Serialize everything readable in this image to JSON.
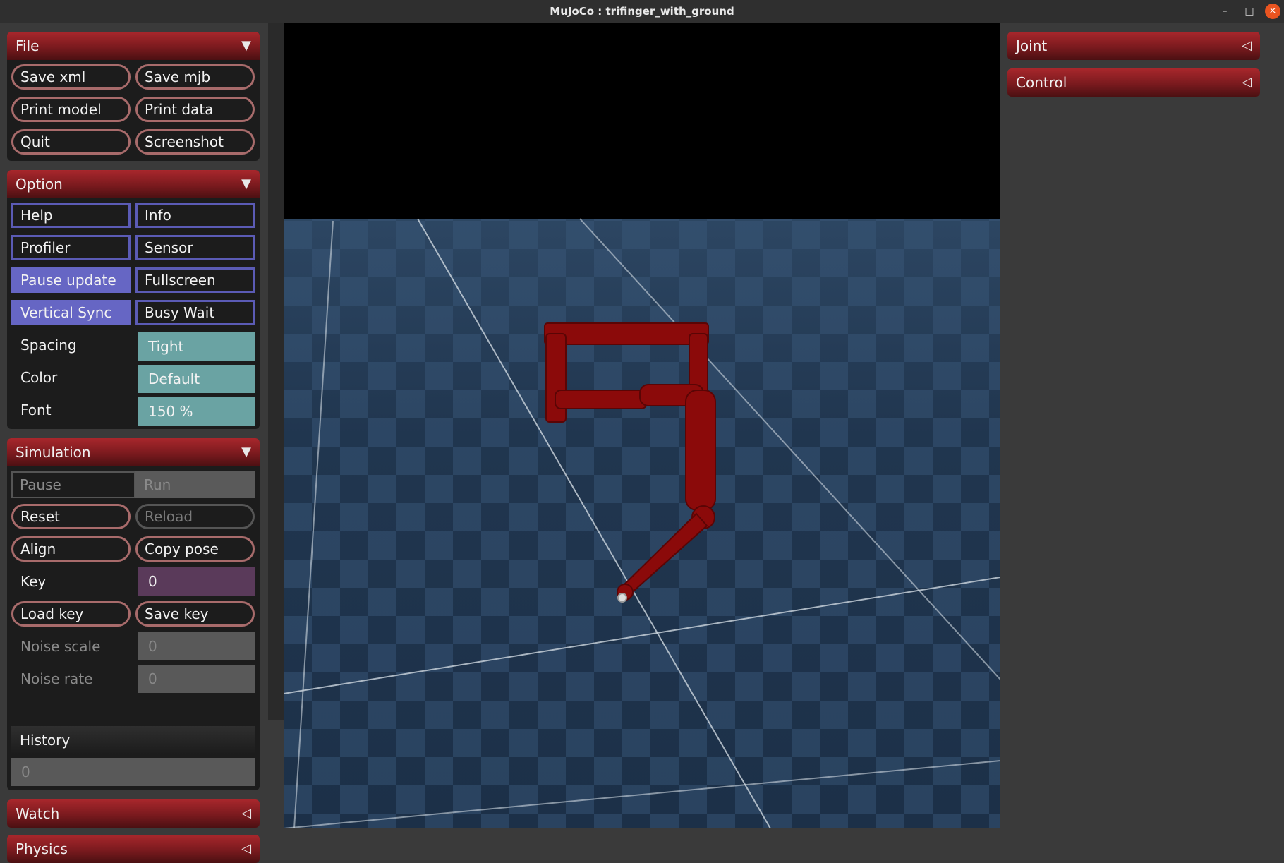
{
  "window": {
    "title": "MuJoCo : trifinger_with_ground",
    "min_glyph": "–",
    "max_glyph": "□",
    "close_glyph": "×"
  },
  "file": {
    "label": "File",
    "arrow": "▼",
    "buttons": [
      "Save xml",
      "Save mjb",
      "Print model",
      "Print data",
      "Quit",
      "Screenshot"
    ]
  },
  "option": {
    "label": "Option",
    "arrow": "▼",
    "toggles": [
      {
        "label": "Help",
        "on": false
      },
      {
        "label": "Info",
        "on": false
      },
      {
        "label": "Profiler",
        "on": false
      },
      {
        "label": "Sensor",
        "on": false
      },
      {
        "label": "Pause update",
        "on": true
      },
      {
        "label": "Fullscreen",
        "on": false
      },
      {
        "label": "Vertical Sync",
        "on": true
      },
      {
        "label": "Busy Wait",
        "on": false
      }
    ],
    "spacing_label": "Spacing",
    "spacing_value": "Tight",
    "color_label": "Color",
    "color_value": "Default",
    "font_label": "Font",
    "font_value": "150 %"
  },
  "simulation": {
    "label": "Simulation",
    "arrow": "▼",
    "pause_label": "Pause",
    "run_label": "Run",
    "reset_label": "Reset",
    "reload_label": "Reload",
    "align_label": "Align",
    "copy_pose_label": "Copy pose",
    "key_label": "Key",
    "key_value": "0",
    "load_key_label": "Load key",
    "save_key_label": "Save key",
    "noise_scale_label": "Noise scale",
    "noise_scale_value": "0",
    "noise_rate_label": "Noise rate",
    "noise_rate_value": "0",
    "history_label": "History",
    "history_value": "0"
  },
  "watch": {
    "label": "Watch",
    "arrow": "◁"
  },
  "physics": {
    "label": "Physics",
    "arrow": "◁"
  },
  "joint": {
    "label": "Joint",
    "arrow": "◁"
  },
  "control": {
    "label": "Control",
    "arrow": "◁"
  },
  "colors": {
    "robot": "#8b0a0a",
    "floor_light": "#34506e",
    "floor_dark": "#1c3048",
    "accent_on": "#6666c4",
    "select": "#6aa3a3"
  }
}
